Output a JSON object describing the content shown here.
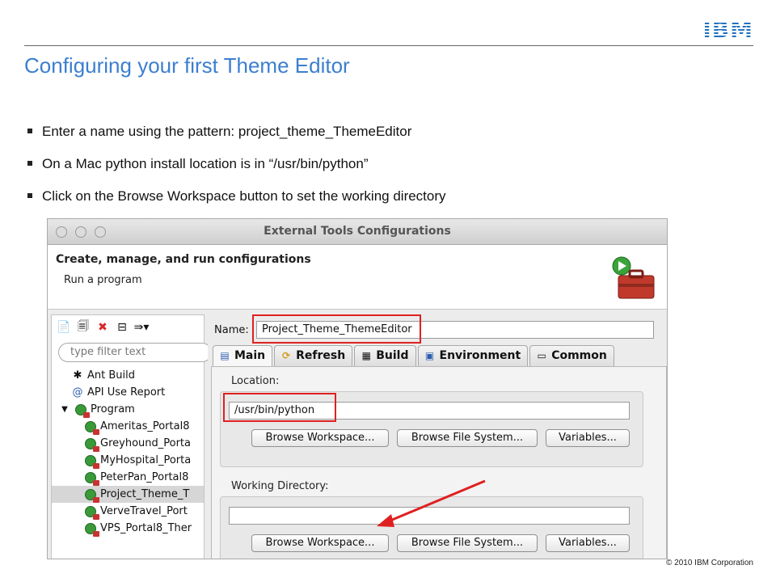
{
  "slide": {
    "title": "Configuring your first Theme Editor",
    "logo": "IBM",
    "bullets": [
      "Enter a name using the pattern: project_theme_ThemeEditor",
      "On a Mac python install location is in “/usr/bin/python”",
      "Click on the Browse Workspace button to set the working directory"
    ],
    "copyright": "© 2010 IBM Corporation"
  },
  "window": {
    "title": "External Tools Configurations",
    "header_title": "Create, manage, and run configurations",
    "header_subtitle": "Run a program",
    "filter_placeholder": "type filter text",
    "tree": [
      {
        "label": "Ant Build",
        "icon": "ant-icon"
      },
      {
        "label": "API Use Report",
        "icon": "api-report-icon"
      },
      {
        "label": "Program",
        "icon": "program-icon"
      },
      {
        "label": "Ameritas_Portal8",
        "icon": "launch-config-icon"
      },
      {
        "label": "Greyhound_Porta",
        "icon": "launch-config-icon"
      },
      {
        "label": "MyHospital_Porta",
        "icon": "launch-config-icon"
      },
      {
        "label": "PeterPan_Portal8",
        "icon": "launch-config-icon"
      },
      {
        "label": "Project_Theme_T",
        "icon": "launch-config-icon"
      },
      {
        "label": "VerveTravel_Port",
        "icon": "launch-config-icon"
      },
      {
        "label": "VPS_Portal8_Ther",
        "icon": "launch-config-icon"
      }
    ],
    "name_label": "Name:",
    "name_value": "Project_Theme_ThemeEditor",
    "tabs": [
      "Main",
      "Refresh",
      "Build",
      "Environment",
      "Common"
    ],
    "location_label": "Location:",
    "location_value": "/usr/bin/python",
    "working_dir_label": "Working Directory:",
    "working_dir_value": "",
    "buttons": {
      "browse_workspace": "Browse Workspace...",
      "browse_file_system": "Browse File System...",
      "variables": "Variables..."
    }
  },
  "colors": {
    "title_blue": "#3b7fd0",
    "ibm_blue": "#1f70c1",
    "annotation_red": "#e02020"
  }
}
